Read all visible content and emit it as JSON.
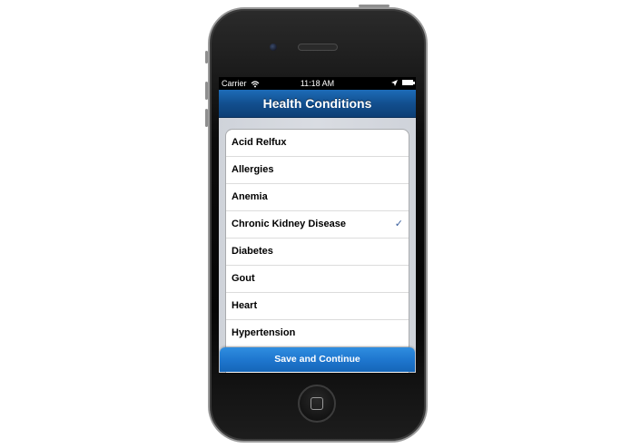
{
  "status_bar": {
    "carrier": "Carrier",
    "time": "11:18 AM",
    "wifi_icon": "wifi-icon",
    "location_icon": "location-arrow-icon",
    "battery_icon": "battery-icon"
  },
  "nav": {
    "title": "Health Conditions"
  },
  "conditions": [
    {
      "label": "Acid Relfux",
      "selected": false
    },
    {
      "label": "Allergies",
      "selected": false
    },
    {
      "label": "Anemia",
      "selected": false
    },
    {
      "label": "Chronic Kidney Disease",
      "selected": true
    },
    {
      "label": "Diabetes",
      "selected": false
    },
    {
      "label": "Gout",
      "selected": false
    },
    {
      "label": "Heart",
      "selected": false
    },
    {
      "label": "Hypertension",
      "selected": false
    }
  ],
  "check_glyph": "✓",
  "save_button": {
    "label": "Save and Continue"
  },
  "colors": {
    "nav_bar": "#124f8f",
    "button": "#1f77cf",
    "checkmark": "#3a5f9c"
  }
}
